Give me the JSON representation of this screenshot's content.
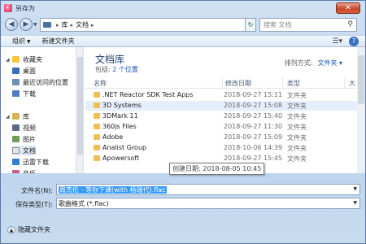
{
  "window": {
    "title": "另存为",
    "close_glyph": "✕"
  },
  "address": {
    "crumbs": [
      "库",
      "文档"
    ],
    "search_placeholder": "搜索 文档"
  },
  "toolbar": {
    "organize": "组织",
    "new_folder": "新建文件夹",
    "help": "?"
  },
  "nav": {
    "items": [
      {
        "label": "收藏夹",
        "icon": "star-icon",
        "level": 0
      },
      {
        "label": "桌面",
        "icon": "desktop-icon",
        "level": 1
      },
      {
        "label": "最近访问的位置",
        "icon": "recent-places-icon",
        "level": 1
      },
      {
        "label": "下载",
        "icon": "download-icon",
        "level": 1
      },
      {
        "label": "库",
        "icon": "library-icon",
        "level": 0
      },
      {
        "label": "视频",
        "icon": "video-icon",
        "level": 1
      },
      {
        "label": "图片",
        "icon": "pictures-icon",
        "level": 1
      },
      {
        "label": "文档",
        "icon": "documents-icon",
        "level": 1
      },
      {
        "label": "迅雷下载",
        "icon": "thunder-download-icon",
        "level": 1
      },
      {
        "label": "音乐",
        "icon": "music-icon",
        "level": 1
      }
    ]
  },
  "library": {
    "title": "文档库",
    "includes_prefix": "包括:",
    "includes_link": "2 个位置",
    "arrange_label": "排列方式:",
    "arrange_value": "文件夹"
  },
  "columns": {
    "name": "名称",
    "date": "修改日期",
    "type": "类型",
    "size": "大"
  },
  "files": [
    {
      "name": ".NET Reactor SDK Test Apps",
      "date": "2018-09-27 15:11",
      "type": "文件夹",
      "kind": "folder"
    },
    {
      "name": "3D Systems",
      "date": "2018-09-27 15:08",
      "type": "文件夹",
      "kind": "folder"
    },
    {
      "name": "3DMark 11",
      "date": "2018-09-27 15:40",
      "type": "文件夹",
      "kind": "folder"
    },
    {
      "name": "360js Files",
      "date": "2018-09-27 11:30",
      "type": "文件夹",
      "kind": "folder"
    },
    {
      "name": "Adobe",
      "date": "2018-09-27 15:09",
      "type": "文件夹",
      "kind": "folder"
    },
    {
      "name": "Analist Group",
      "date": "2018-10-06 14:39",
      "type": "文件夹",
      "kind": "folder"
    },
    {
      "name": "Apowersoft",
      "date": "2018-09-27 15:45",
      "type": "文件夹",
      "kind": "folder"
    }
  ],
  "tooltip": "创建日期: 2018-08-05 10:45",
  "form": {
    "filename_label": "文件名(N):",
    "filename_value": "周杰伦 - 等你下课(with 杨瑞代).flac",
    "type_label": "保存类型(T):",
    "type_value": "歌曲格式 (*.flac)"
  },
  "bottom": {
    "hide_folders": "隐藏文件夹"
  },
  "colors": {
    "accent": "#1a56b8",
    "selection": "#3399ff"
  }
}
